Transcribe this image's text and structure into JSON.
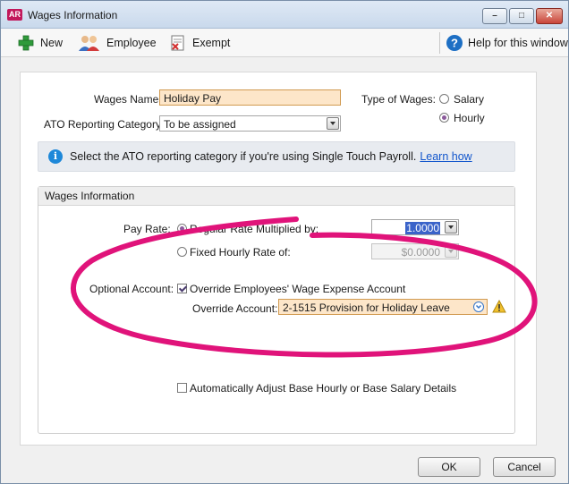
{
  "window": {
    "app_badge": "AR",
    "title": "Wages Information",
    "controls": [
      "minimize",
      "maximize",
      "close"
    ]
  },
  "toolbar": {
    "new_label": "New",
    "employee_label": "Employee",
    "exempt_label": "Exempt",
    "help_label": "Help for this window"
  },
  "form": {
    "wages_name_label": "Wages Name:",
    "wages_name_value": "Holiday Pay",
    "ato_label": "ATO Reporting Category:",
    "ato_value": "To be assigned",
    "type_label": "Type of Wages:",
    "type_options": [
      {
        "label": "Salary",
        "selected": false
      },
      {
        "label": "Hourly",
        "selected": true
      }
    ]
  },
  "info": {
    "text": "Select the ATO reporting category if you're using Single Touch Payroll.",
    "link": "Learn how"
  },
  "wages_group": {
    "title": "Wages Information",
    "pay_rate_label": "Pay Rate:",
    "regular_rate_label": "Regular Rate Multiplied by:",
    "regular_rate_value": "1.0000",
    "regular_selected": true,
    "fixed_rate_label": "Fixed Hourly Rate of:",
    "fixed_rate_value": "$0.0000",
    "optional_account_label": "Optional Account:",
    "override_checkbox_label": "Override Employees' Wage Expense Account",
    "override_checked": true,
    "override_account_label": "Override Account:",
    "override_account_value": "2-1515 Provision for Holiday Leave",
    "auto_adjust_label": "Automatically Adjust Base Hourly or Base Salary Details",
    "auto_adjust_checked": false
  },
  "buttons": {
    "ok": "OK",
    "cancel": "Cancel"
  },
  "colors": {
    "accent_badge": "#c2185b",
    "highlight_field": "#fde6c9",
    "annotation_ellipse": "#e0137a",
    "info_icon": "#1e88d9",
    "link": "#1155cc"
  }
}
